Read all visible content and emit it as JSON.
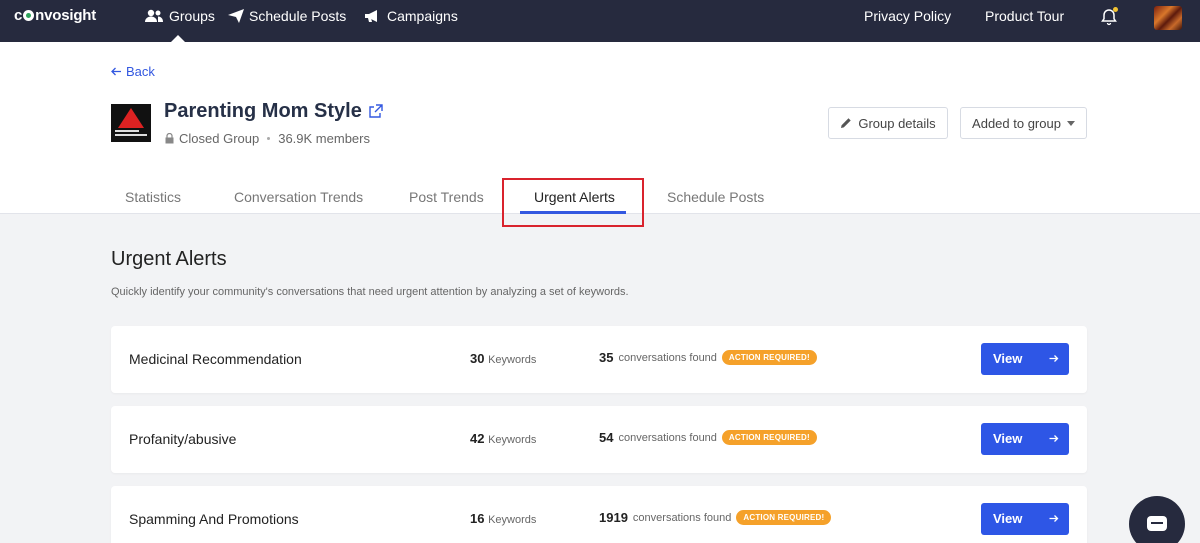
{
  "nav": {
    "logo": "convosight",
    "logo_pre": "c",
    "logo_post": "nvosight",
    "items": [
      {
        "label": "Groups",
        "icon": "users-icon"
      },
      {
        "label": "Schedule Posts",
        "icon": "paper-plane-icon"
      },
      {
        "label": "Campaigns",
        "icon": "megaphone-icon"
      }
    ],
    "privacy": "Privacy Policy",
    "tour": "Product Tour"
  },
  "header": {
    "back": "Back",
    "group_name": "Parenting Mom Style",
    "group_type": "Closed Group",
    "members": "36.9K members",
    "group_details": "Group details",
    "added": "Added to group"
  },
  "tabs": [
    {
      "label": "Statistics"
    },
    {
      "label": "Conversation Trends"
    },
    {
      "label": "Post Trends"
    },
    {
      "label": "Urgent Alerts",
      "active": true
    },
    {
      "label": "Schedule Posts"
    }
  ],
  "main": {
    "title": "Urgent Alerts",
    "subtitle": "Quickly identify your community's conversations that need urgent attention by analyzing a set of keywords.",
    "keywords_label": "Keywords",
    "conversations_label": "conversations found",
    "badge": "ACTION REQUIRED!",
    "view": "View",
    "alerts": [
      {
        "name": "Medicinal Recommendation",
        "keywords": "30",
        "conversations": "35"
      },
      {
        "name": "Profanity/abusive",
        "keywords": "42",
        "conversations": "54"
      },
      {
        "name": "Spamming And Promotions",
        "keywords": "16",
        "conversations": "1919"
      }
    ]
  },
  "colors": {
    "nav_bg": "#262a3e",
    "accent": "#2e56e6",
    "badge": "#f5a12a",
    "highlight": "#d9232d"
  }
}
